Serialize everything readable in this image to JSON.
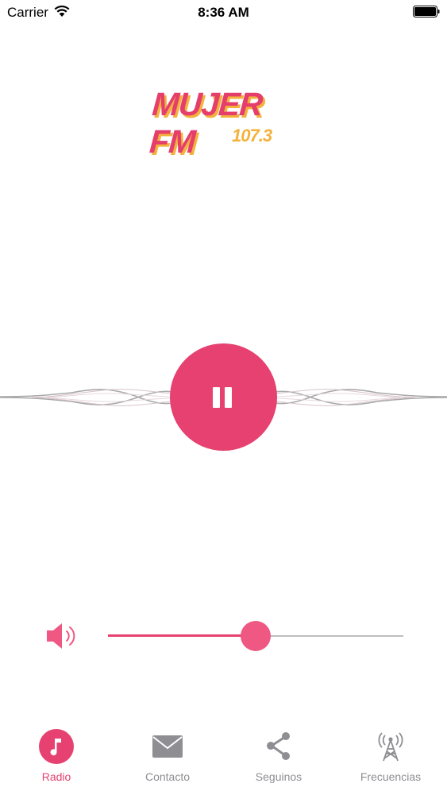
{
  "status_bar": {
    "carrier": "Carrier",
    "time": "8:36 AM",
    "wifi_icon": "wifi-icon",
    "battery_icon": "battery-full-icon"
  },
  "logo": {
    "name": "MUJER FM",
    "frequency": "107.3"
  },
  "player": {
    "state": "playing",
    "button_icon": "pause-icon"
  },
  "volume": {
    "icon": "speaker-icon",
    "level": 0.5
  },
  "tabs": [
    {
      "label": "Radio",
      "icon": "music-note-icon",
      "active": true
    },
    {
      "label": "Contacto",
      "icon": "envelope-icon",
      "active": false
    },
    {
      "label": "Seguinos",
      "icon": "share-icon",
      "active": false
    },
    {
      "label": "Frecuencias",
      "icon": "antenna-icon",
      "active": false
    }
  ],
  "colors": {
    "accent": "#e64170",
    "logo_pink": "#e53e6b",
    "logo_gold": "#f3b23c",
    "inactive": "#8e8e93",
    "track": "#bdbdbd"
  }
}
